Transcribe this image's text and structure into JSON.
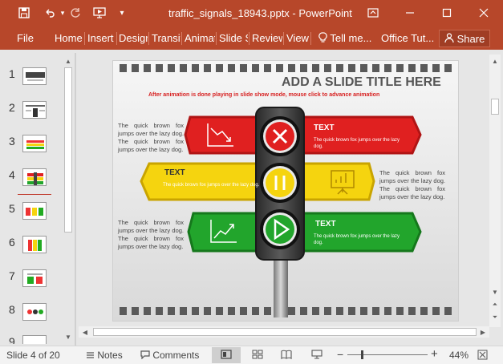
{
  "titlebar": {
    "title": "traffic_signals_18943.pptx - PowerPoint",
    "icons": [
      "save-icon",
      "undo-icon",
      "redo-icon",
      "start-from-beginning-icon",
      "customize-qat-icon",
      "ribbon-display-icon",
      "minimize-icon",
      "restore-icon",
      "close-icon"
    ]
  },
  "ribbon": {
    "tabs": [
      "File",
      "Home",
      "Insert",
      "Design",
      "Transitions",
      "Animations",
      "Slide Show",
      "Review",
      "View"
    ],
    "tell_me": "Tell me...",
    "office_tab": "Office Tut...",
    "share": "Share"
  },
  "thumbnails": {
    "numbers": [
      "1",
      "2",
      "3",
      "4",
      "5",
      "6",
      "7",
      "8",
      "9"
    ],
    "selected": "4"
  },
  "slide": {
    "title": "ADD A SLIDE TITLE HERE",
    "subtitle": "After animation is done playing in slide show mode, mouse click to advance animation",
    "paragraph": "The quick brown fox jumps over the lazy dog. The quick brown fox jumps over the lazy dog.",
    "signs": [
      {
        "label": "TEXT",
        "body": "The quick brown fox jumps over the lazy dog.",
        "color": "#e02020"
      },
      {
        "label": "TEXT",
        "body": "The quick brown fox jumps over the lazy dog.",
        "color": "#f5d40f"
      },
      {
        "label": "TEXT",
        "body": "The quick brown fox jumps over the lazy dog.",
        "color": "#22a52c"
      }
    ]
  },
  "status": {
    "slide_info": "Slide 4 of 20",
    "notes": "Notes",
    "comments": "Comments",
    "zoom_minus": "−",
    "zoom_plus": "+",
    "zoom": "44%"
  }
}
